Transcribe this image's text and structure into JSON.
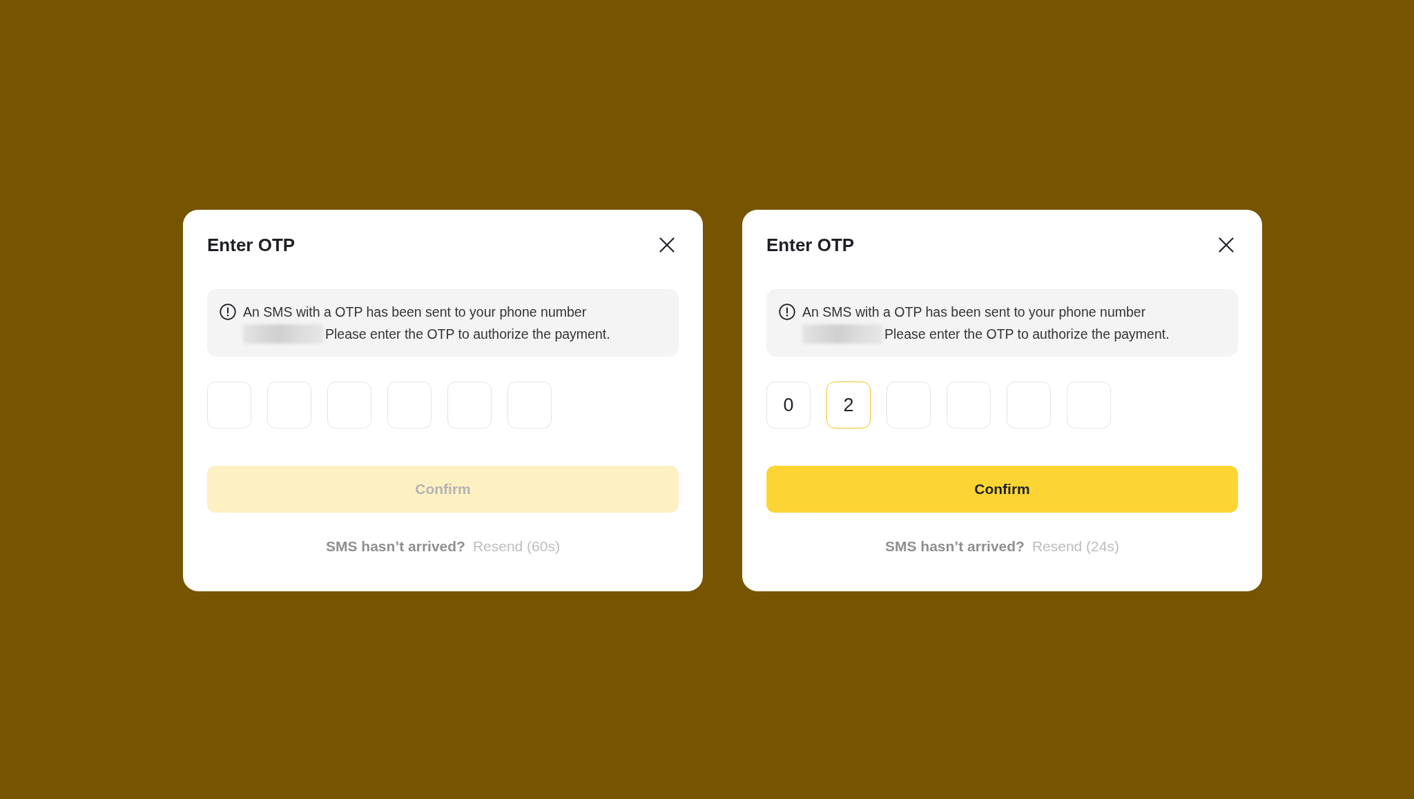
{
  "dialogs": [
    {
      "title": "Enter OTP",
      "notice": {
        "line_1": "An SMS with a OTP has been sent to your phone number",
        "line_2": "Please enter the OTP to authorize the payment."
      },
      "otp_digits": [
        {
          "focused": false
        },
        {
          "focused": false
        },
        {
          "focused": false
        },
        {
          "focused": false
        },
        {
          "focused": false
        },
        {
          "focused": false
        }
      ],
      "confirm_button": {
        "label": "Confirm",
        "disabled": true
      },
      "footer": {
        "prompt": "SMS hasn’t arrived?",
        "resend": "Resend (60s)"
      }
    },
    {
      "title": "Enter OTP",
      "notice": {
        "line_1": "An SMS with a OTP has been sent to your phone number",
        "line_2": "Please enter the OTP to authorize the payment."
      },
      "otp_digits": [
        {
          "value": "0",
          "focused": false
        },
        {
          "value": "2",
          "focused": true
        },
        {
          "focused": false
        },
        {
          "focused": false
        },
        {
          "focused": false
        },
        {
          "focused": false
        }
      ],
      "confirm_button": {
        "label": "Confirm",
        "disabled": false
      },
      "footer": {
        "prompt": "SMS hasn’t arrived?",
        "resend": "Resend (24s)"
      }
    }
  ]
}
